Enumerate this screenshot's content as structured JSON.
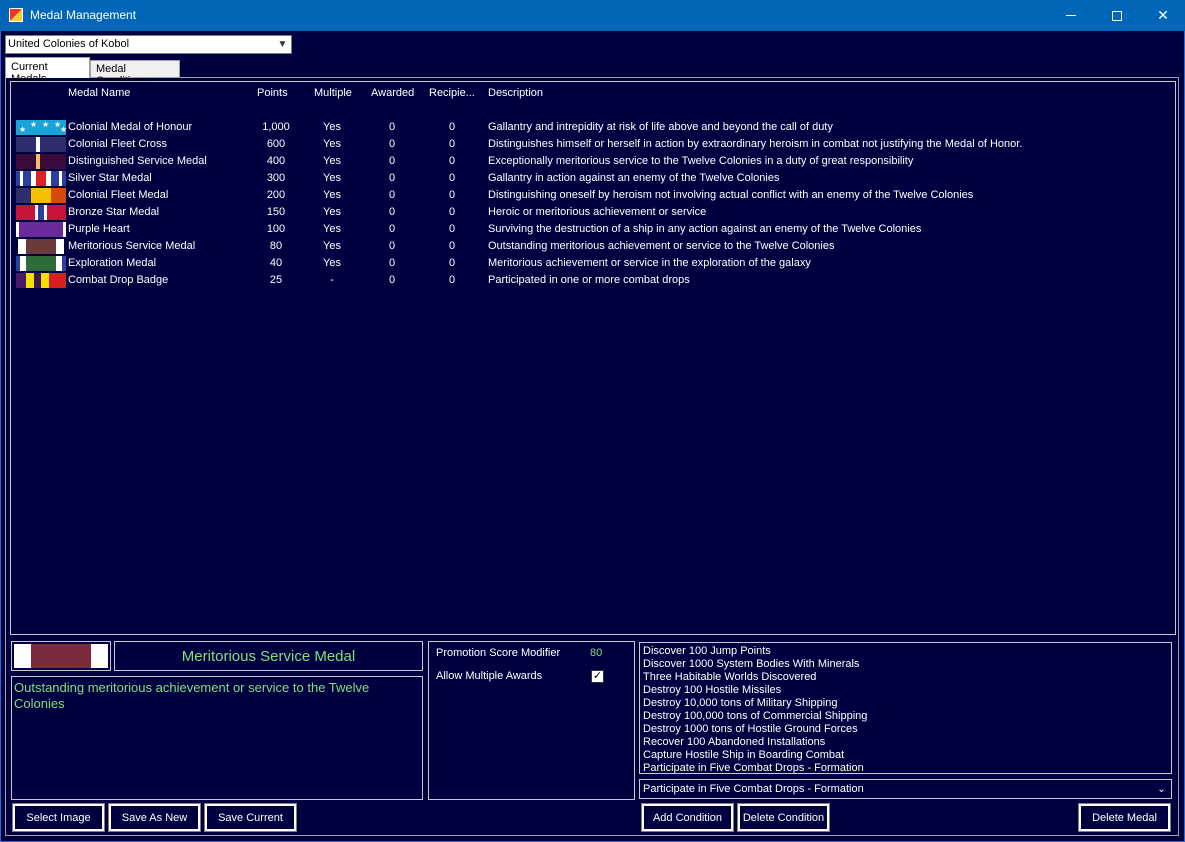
{
  "window": {
    "title": "Medal Management"
  },
  "race_select": {
    "value": "United Colonies of Kobol"
  },
  "tabs": [
    {
      "label": "Current Medals",
      "active": true
    },
    {
      "label": "Medal Conditions",
      "active": false
    }
  ],
  "medal_table": {
    "columns": [
      "Medal Name",
      "Points",
      "Multiple",
      "Awarded",
      "Recipie...",
      "Description"
    ],
    "rows": [
      {
        "name": "Colonial Medal of Honour",
        "points": "1,000",
        "multiple": "Yes",
        "awarded": "0",
        "recipients": "0",
        "description": "Gallantry and intrepidity at risk of life above and beyond the call of duty"
      },
      {
        "name": "Colonial Fleet Cross",
        "points": "600",
        "multiple": "Yes",
        "awarded": "0",
        "recipients": "0",
        "description": "Distinguishes himself or herself in action by extraordinary heroism in combat not justifying the Medal of Honor."
      },
      {
        "name": "Distinguished Service Medal",
        "points": "400",
        "multiple": "Yes",
        "awarded": "0",
        "recipients": "0",
        "description": "Exceptionally meritorious service to the Twelve Colonies in a duty of great responsibility"
      },
      {
        "name": "Silver Star Medal",
        "points": "300",
        "multiple": "Yes",
        "awarded": "0",
        "recipients": "0",
        "description": "Gallantry in action against an enemy of the Twelve Colonies"
      },
      {
        "name": "Colonial Fleet Medal",
        "points": "200",
        "multiple": "Yes",
        "awarded": "0",
        "recipients": "0",
        "description": "Distinguishing oneself by heroism not involving actual conflict with an enemy of the Twelve Colonies"
      },
      {
        "name": "Bronze Star Medal",
        "points": "150",
        "multiple": "Yes",
        "awarded": "0",
        "recipients": "0",
        "description": "Heroic or meritorious achievement or service"
      },
      {
        "name": "Purple Heart",
        "points": "100",
        "multiple": "Yes",
        "awarded": "0",
        "recipients": "0",
        "description": "Surviving the destruction of a ship in any action against an enemy of the Twelve Colonies"
      },
      {
        "name": "Meritorious Service Medal",
        "points": "80",
        "multiple": "Yes",
        "awarded": "0",
        "recipients": "0",
        "description": "Outstanding meritorious achievement or service to the Twelve Colonies"
      },
      {
        "name": "Exploration Medal",
        "points": "40",
        "multiple": "Yes",
        "awarded": "0",
        "recipients": "0",
        "description": "Meritorious achievement or service in the exploration of the galaxy"
      },
      {
        "name": "Combat Drop Badge",
        "points": "25",
        "multiple": "-",
        "awarded": "0",
        "recipients": "0",
        "description": "Participated in one or more combat drops"
      }
    ]
  },
  "selected_medal": {
    "name": "Meritorious Service Medal",
    "description": "Outstanding meritorious achievement or service to the Twelve Colonies"
  },
  "options": {
    "promotion_label": "Promotion Score Modifier",
    "promotion_value": "80",
    "multiple_label": "Allow Multiple Awards",
    "multiple_checked": "✓"
  },
  "conditions": [
    "Discover 100 Jump Points",
    "Discover 1000 System Bodies With Minerals",
    "Three Habitable Worlds Discovered",
    "Destroy 100 Hostile Missiles",
    "Destroy 10,000 tons of Military Shipping",
    "Destroy 100,000 tons of Commercial Shipping",
    "Destroy 1000 tons of Hostile Ground Forces",
    "Recover 100 Abandoned Installations",
    "Capture Hostile Ship in Boarding Combat",
    "Participate in Five Combat Drops - Formation"
  ],
  "condition_select": {
    "value": "Participate in Five Combat Drops - Formation"
  },
  "buttons": {
    "select_image": "Select Image",
    "save_as_new": "Save As New",
    "save_current": "Save Current",
    "add_condition": "Add Condition",
    "delete_condition": "Delete Condition",
    "delete_medal": "Delete Medal"
  },
  "colors": {
    "background": "#000040",
    "titlebar": "#0066b8",
    "highlight_text": "#7ee07e"
  }
}
